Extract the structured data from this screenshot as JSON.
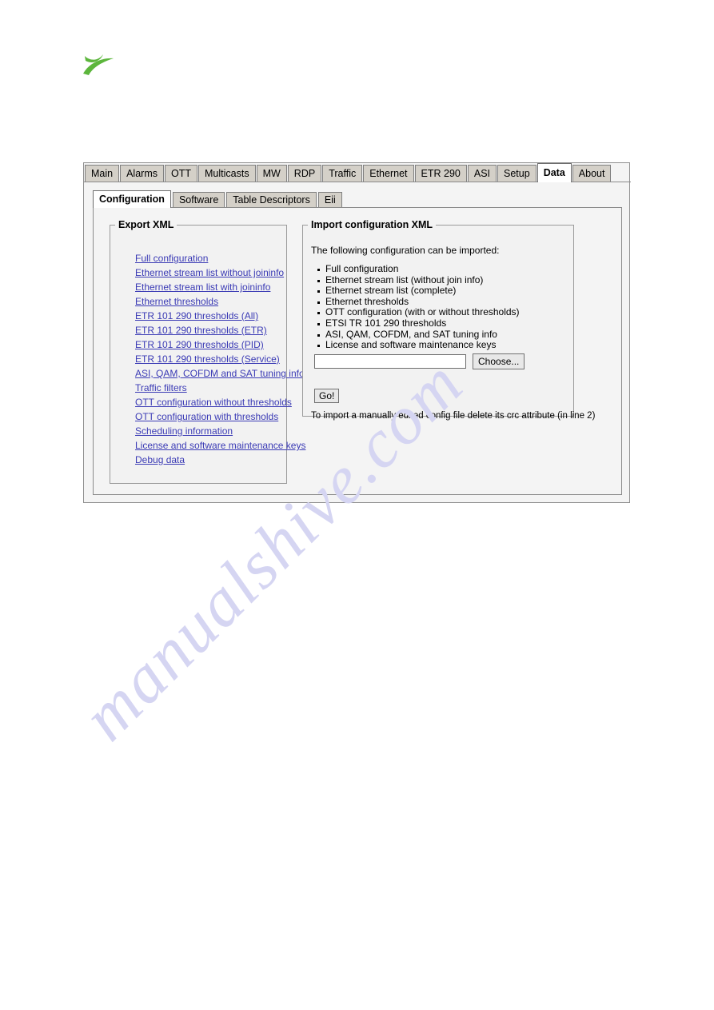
{
  "watermark": {
    "text": "manualshive.com"
  },
  "logo": {
    "name": "company-logo",
    "color": "#5cb63c"
  },
  "main_tabs": [
    {
      "label": "Main",
      "active": false
    },
    {
      "label": "Alarms",
      "active": false
    },
    {
      "label": "OTT",
      "active": false
    },
    {
      "label": "Multicasts",
      "active": false
    },
    {
      "label": "MW",
      "active": false
    },
    {
      "label": "RDP",
      "active": false
    },
    {
      "label": "Traffic",
      "active": false
    },
    {
      "label": "Ethernet",
      "active": false
    },
    {
      "label": "ETR 290",
      "active": false
    },
    {
      "label": "ASI",
      "active": false
    },
    {
      "label": "Setup",
      "active": false
    },
    {
      "label": "Data",
      "active": true
    },
    {
      "label": "About",
      "active": false
    }
  ],
  "sub_tabs": [
    {
      "label": "Configuration",
      "active": true
    },
    {
      "label": "Software",
      "active": false
    },
    {
      "label": "Table Descriptors",
      "active": false
    },
    {
      "label": "Eii",
      "active": false
    }
  ],
  "export": {
    "legend": "Export XML",
    "link_color": "#3b3bb5",
    "links": [
      "Full configuration",
      "Ethernet stream list without joininfo",
      "Ethernet stream list with joininfo",
      "Ethernet thresholds",
      "ETR 101 290 thresholds (All)",
      "ETR 101 290 thresholds (ETR)",
      "ETR 101 290 thresholds (PID)",
      "ETR 101 290 thresholds (Service)",
      "ASI, QAM, COFDM and SAT tuning info",
      "Traffic filters",
      "OTT configuration without thresholds",
      "OTT configuration with thresholds",
      "Scheduling information",
      "License and software maintenance keys",
      "Debug data"
    ]
  },
  "import": {
    "legend": "Import configuration XML",
    "intro": "The following configuration can be imported:",
    "items": [
      "Full configuration",
      "Ethernet stream list (without join info)",
      "Ethernet stream list (complete)",
      "Ethernet thresholds",
      "OTT configuration (with or without thresholds)",
      "ETSI TR 101 290 thresholds",
      "ASI, QAM, COFDM, and SAT tuning info",
      "License and software maintenance keys"
    ],
    "file_value": "",
    "file_placeholder": "",
    "choose_label": "Choose...",
    "go_label": "Go!",
    "note": "To import a manually edited config file delete its crc attribute (in line 2)"
  }
}
